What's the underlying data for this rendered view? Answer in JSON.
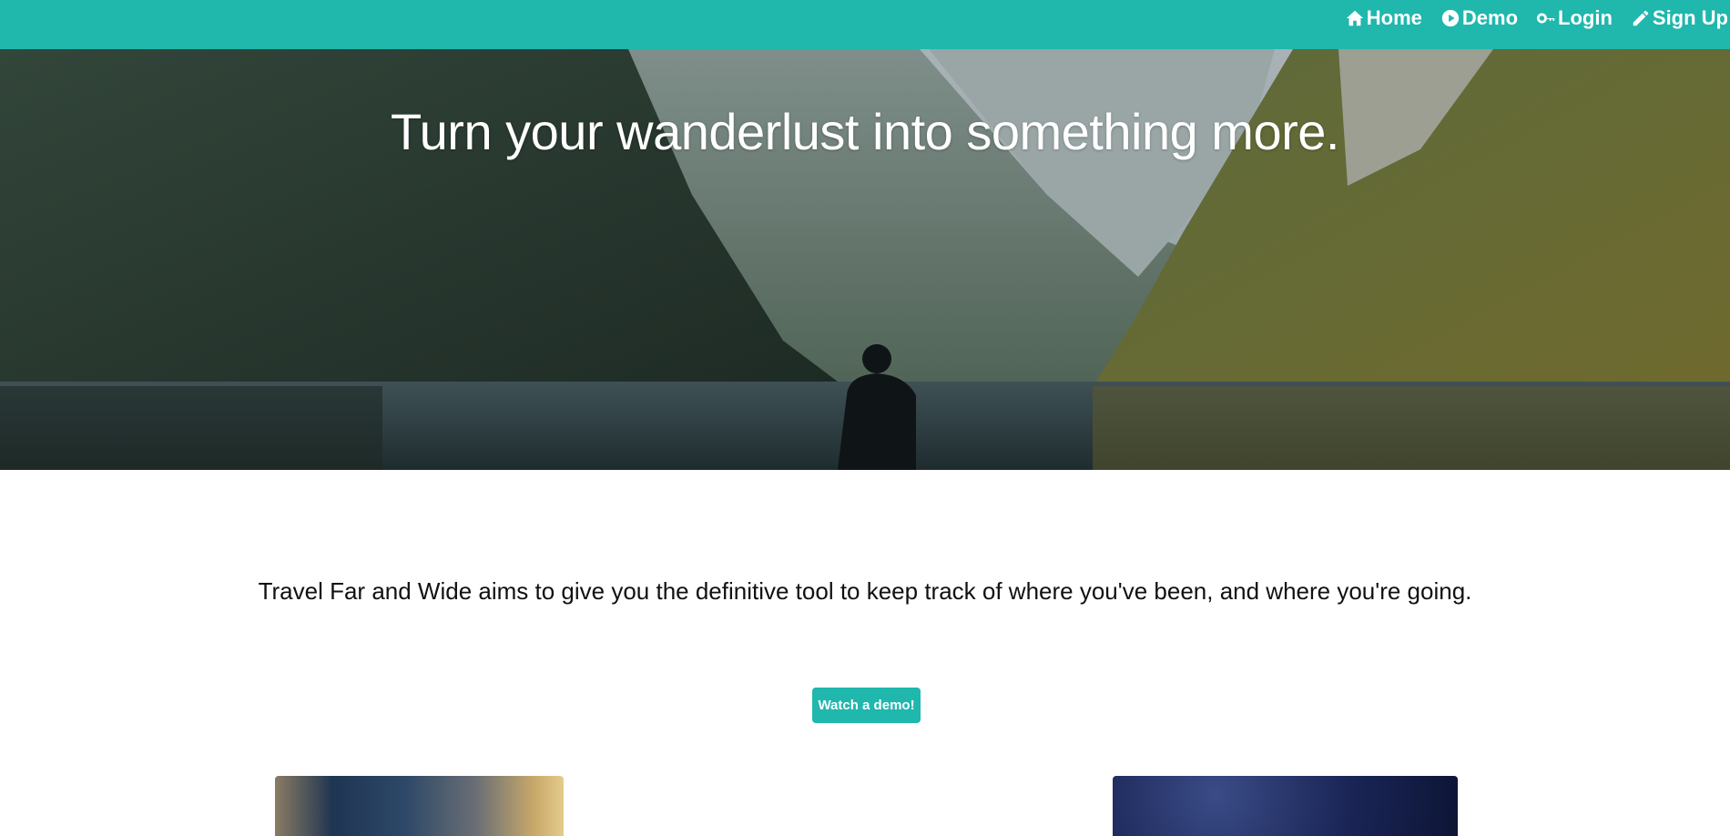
{
  "nav": {
    "items": [
      {
        "label": "Home",
        "icon": "home-icon"
      },
      {
        "label": "Demo",
        "icon": "play-circle-icon"
      },
      {
        "label": "Login",
        "icon": "key-icon"
      },
      {
        "label": "Sign Up",
        "icon": "pencil-icon"
      }
    ]
  },
  "hero": {
    "title": "Turn your wanderlust into something more."
  },
  "main": {
    "tagline": "Travel Far and Wide aims to give you the definitive tool to keep track of where you've been, and where you're going.",
    "demo_button_label": "Watch a demo!"
  },
  "colors": {
    "accent": "#20b7ad",
    "text": "#111111"
  }
}
